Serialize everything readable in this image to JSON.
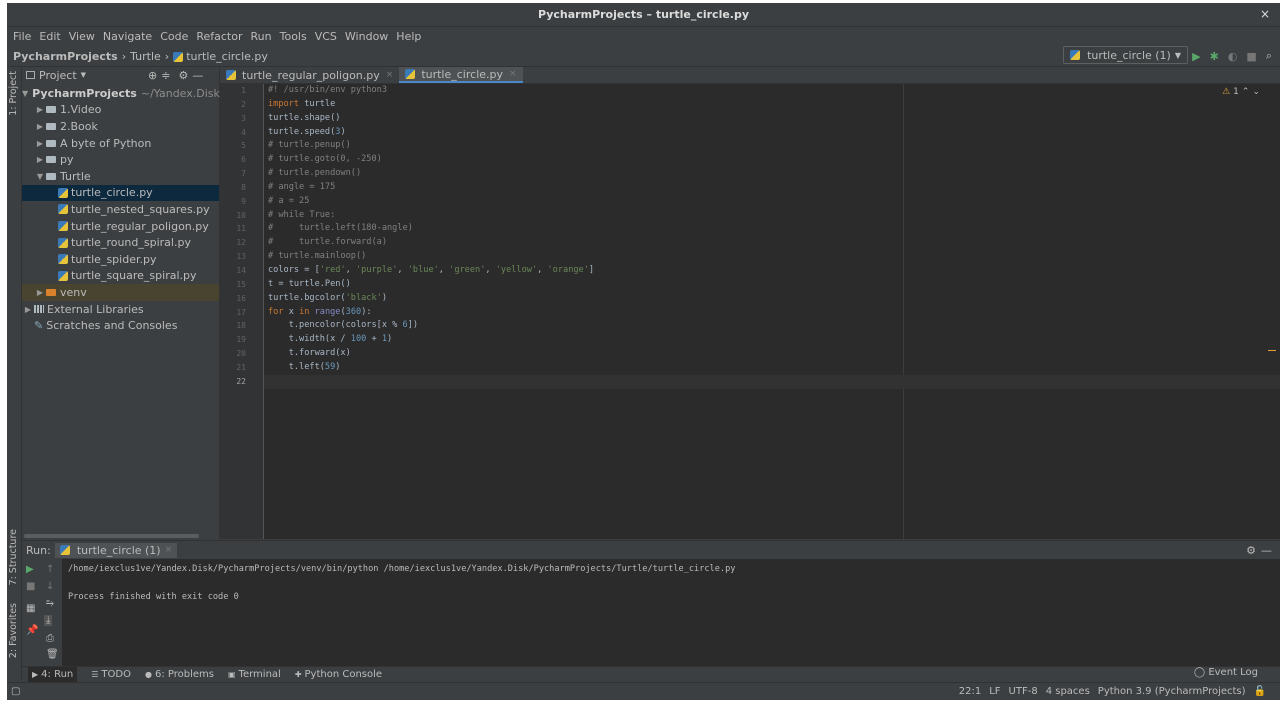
{
  "window": {
    "title": "PycharmProjects – turtle_circle.py",
    "close": "×"
  },
  "menu": [
    "File",
    "Edit",
    "View",
    "Navigate",
    "Code",
    "Refactor",
    "Run",
    "Tools",
    "VCS",
    "Window",
    "Help"
  ],
  "breadcrumb": {
    "root": "PycharmProjects",
    "folder": "Turtle",
    "file": "turtle_circle.py"
  },
  "run_config": {
    "label": "turtle_circle (1)"
  },
  "side_labels": {
    "project": "1: Project",
    "structure": "7: Structure",
    "favorites": "2: Favorites"
  },
  "project_panel": {
    "title": "Project",
    "root": {
      "name": "PycharmProjects",
      "path": "~/Yandex.Disk/Py"
    },
    "items": [
      {
        "label": "1.Video",
        "indent": 1,
        "type": "folder",
        "expanded": false
      },
      {
        "label": "2.Book",
        "indent": 1,
        "type": "folder",
        "expanded": false
      },
      {
        "label": "A byte of Python",
        "indent": 1,
        "type": "folder",
        "expanded": false
      },
      {
        "label": "py",
        "indent": 1,
        "type": "folder",
        "expanded": false
      },
      {
        "label": "Turtle",
        "indent": 1,
        "type": "folder",
        "expanded": true
      },
      {
        "label": "turtle_circle.py",
        "indent": 2,
        "type": "py",
        "selected": true
      },
      {
        "label": "turtle_nested_squares.py",
        "indent": 2,
        "type": "py"
      },
      {
        "label": "turtle_regular_poligon.py",
        "indent": 2,
        "type": "py"
      },
      {
        "label": "turtle_round_spiral.py",
        "indent": 2,
        "type": "py"
      },
      {
        "label": "turtle_spider.py",
        "indent": 2,
        "type": "py"
      },
      {
        "label": "turtle_square_spiral.py",
        "indent": 2,
        "type": "py"
      },
      {
        "label": "venv",
        "indent": 1,
        "type": "venv",
        "expanded": false
      },
      {
        "label": "External Libraries",
        "indent": 0,
        "type": "lib",
        "expanded": false
      },
      {
        "label": "Scratches and Consoles",
        "indent": 0,
        "type": "scratch"
      }
    ]
  },
  "editor_tabs": [
    {
      "label": "turtle_regular_poligon.py",
      "active": false
    },
    {
      "label": "turtle_circle.py",
      "active": true
    }
  ],
  "inspection": {
    "count": "1"
  },
  "code_lines": [
    "#! /usr/bin/env python3",
    "import turtle",
    "turtle.shape()",
    "turtle.speed(3)",
    "# turtle.penup()",
    "# turtle.goto(0, -250)",
    "# turtle.pendown()",
    "# angle = 175",
    "# a = 25",
    "# while True:",
    "#     turtle.left(180-angle)",
    "#     turtle.forward(a)",
    "# turtle.mainloop()",
    "colors = ['red', 'purple', 'blue', 'green', 'yellow', 'orange']",
    "t = turtle.Pen()",
    "turtle.bgcolor('black')",
    "for x in range(360):",
    "    t.pencolor(colors[x % 6])",
    "    t.width(x / 100 + 1)",
    "    t.forward(x)",
    "    t.left(59)",
    ""
  ],
  "current_line": 22,
  "run_panel": {
    "label": "Run:",
    "tab": "turtle_circle (1)",
    "output": [
      "/home/iexclus1ve/Yandex.Disk/PycharmProjects/venv/bin/python /home/iexclus1ve/Yandex.Disk/PycharmProjects/Turtle/turtle_circle.py",
      "",
      "Process finished with exit code 0"
    ]
  },
  "bottom_tabs": [
    {
      "label": "4: Run",
      "icon": "play-icon",
      "active": true
    },
    {
      "label": "TODO",
      "icon": "list-icon"
    },
    {
      "label": "6: Problems",
      "icon": "info-icon"
    },
    {
      "label": "Terminal",
      "icon": "terminal-icon"
    },
    {
      "label": "Python Console",
      "icon": "python-icon"
    }
  ],
  "event_log": "Event Log",
  "status": {
    "position": "22:1",
    "line_sep": "LF",
    "encoding": "UTF-8",
    "indent": "4 spaces",
    "interpreter": "Python 3.9 (PycharmProjects)"
  }
}
